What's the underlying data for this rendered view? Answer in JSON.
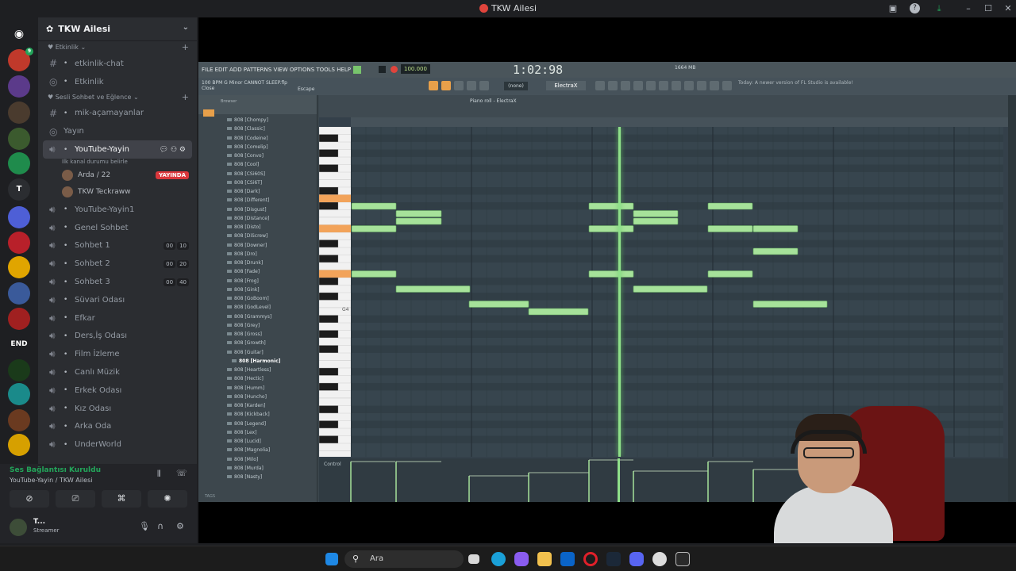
{
  "window": {
    "title": "TKW Ailesi",
    "controls": [
      "inbox-icon",
      "help-icon",
      "download-icon",
      "minimize-icon",
      "maximize-icon",
      "close-icon"
    ]
  },
  "server": {
    "name": "TKW Ailesi",
    "rail": [
      {
        "icon": "discord-home-icon",
        "color": "#313338"
      },
      {
        "color": "#c0392b",
        "badge": "9"
      },
      {
        "color": "#5b3a8a"
      },
      {
        "color": "#4a3b2e"
      },
      {
        "color": "#3b5a2e"
      },
      {
        "color": "#1f8b4c"
      },
      {
        "label": "T",
        "color": "#2b2d31"
      },
      {
        "color": "#4e5fd6"
      },
      {
        "color": "#b8202a"
      },
      {
        "color": "#e0a500"
      },
      {
        "color": "#3a5a9a"
      },
      {
        "color": "#a02020"
      },
      {
        "label": "END",
        "color": "#1e1f22"
      },
      {
        "color": "#1a3a1a"
      },
      {
        "color": "#1a8a8a"
      },
      {
        "color": "#6a3a20"
      },
      {
        "color": "#d6a000"
      }
    ]
  },
  "sidebar": {
    "categories": [
      {
        "name": "Etkinlik",
        "channels": [
          {
            "type": "text",
            "name": "etkinlik-chat",
            "emoji": "purple-icon"
          },
          {
            "type": "stage",
            "name": "Etkinlik",
            "emoji": "purple-icon"
          }
        ]
      },
      {
        "name": "Sesli Sohbet ve Eğlence",
        "channels": [
          {
            "type": "text",
            "name": "mik-açamayanlar",
            "emoji": "mic-icon"
          },
          {
            "type": "stage",
            "name": "Yayın",
            "emoji": ""
          },
          {
            "type": "voice",
            "name": "YouTube-Yayin",
            "emoji": "purple-icon",
            "active": true,
            "status": "İlk kanal durumu belirle"
          }
        ]
      }
    ],
    "voice_users": [
      {
        "name": "Arda / 22",
        "live": "YAYINDA"
      },
      {
        "name": "TKW Teckraww",
        "live": ""
      }
    ],
    "voice_channels": [
      {
        "name": "YouTube-Yayin1",
        "emoji": "purple-icon"
      },
      {
        "name": "Genel Sohbet",
        "emoji": "dot-icon"
      },
      {
        "name": "Sohbet 1",
        "emoji": "dot-icon",
        "counts": [
          "00",
          "10"
        ]
      },
      {
        "name": "Sohbet 2",
        "emoji": "dot-icon",
        "counts": [
          "00",
          "20"
        ]
      },
      {
        "name": "Sohbet 3",
        "emoji": "dot-icon",
        "counts": [
          "00",
          "40"
        ]
      },
      {
        "name": "Süvari Odası",
        "emoji": "horse-icon"
      },
      {
        "name": "Efkar",
        "emoji": "guitar-icon"
      },
      {
        "name": "Ders,İş Odası",
        "emoji": "hand-icon"
      },
      {
        "name": "Film İzleme",
        "emoji": "film-icon"
      },
      {
        "name": "Canlı Müzik",
        "emoji": "mic-icon"
      },
      {
        "name": "Erkek Odası",
        "emoji": "man-icon"
      },
      {
        "name": "Kız Odası",
        "emoji": "girl-icon"
      },
      {
        "name": "Arka Oda",
        "emoji": "no-entry-icon"
      },
      {
        "name": "UnderWorld",
        "emoji": "skull-icon"
      }
    ]
  },
  "voice_panel": {
    "status": "Ses Bağlantısı Kuruldu",
    "location": "YouTube-Yayin / TKW Ailesi"
  },
  "user_panel": {
    "name": "T...",
    "status": "Streamer"
  },
  "fl_studio": {
    "menu": "FILE EDIT ADD PATTERNS VIEW OPTIONS TOOLS HELP",
    "tempo": "100.000",
    "time": "1:02:98",
    "hint": "100 BPM G Minor CANNOT SLEEP.flp",
    "hint2": "Close",
    "escape": "Escape",
    "pattern": "(none)",
    "instrument": "ElectraX",
    "news": "Today: A newer version of FL Studio is available!",
    "cpu": "1664 MB",
    "piano_roll_title": "Piano roll - ElectraX",
    "control_label": "Control",
    "browser_label": "Browser",
    "tags_label": "TAGS",
    "key_label": "G4",
    "browser_items": [
      "808 [Chompy]",
      "808 [Classic]",
      "808 [Codeine]",
      "808 [Comelip]",
      "808 [Convo]",
      "808 [Cool]",
      "808 [CSi60S]",
      "808 [CSi6T]",
      "808 [Dark]",
      "808 [Different]",
      "808 [Disgust]",
      "808 [Distance]",
      "808 [Disto]",
      "808 [DiScrew]",
      "808 [Downer]",
      "808 [Dro]",
      "808 [Drunk]",
      "808 [Fade]",
      "808 [Frog]",
      "808 [Gink]",
      "808 [GoBoom]",
      "808 [GodLevel]",
      "808 [Grammys]",
      "808 [Grey]",
      "808 [Gross]",
      "808 [Growth]",
      "808 [Guitar]",
      "808 [Harmonic]",
      "808 [Heartless]",
      "808 [Hectic]",
      "808 [Humm]",
      "808 [Huncho]",
      "808 [Karden]",
      "808 [Kickback]",
      "808 [Legend]",
      "808 [Lex]",
      "808 [Lucid]",
      "808 [Magnolia]",
      "808 [Milo]",
      "808 [Murda]",
      "808 [Nasty]"
    ],
    "selected_browser_item": "808 [Harmonic]"
  },
  "taskbar": {
    "search_placeholder": "Ara",
    "apps": [
      "start-icon",
      "search-icon",
      "file-explorer-icon",
      "edge-icon",
      "copilot-icon",
      "folder-icon",
      "outlook-icon",
      "opera-icon",
      "steam-icon",
      "discord-icon",
      "chrome-icon",
      "epic-games-icon"
    ]
  }
}
